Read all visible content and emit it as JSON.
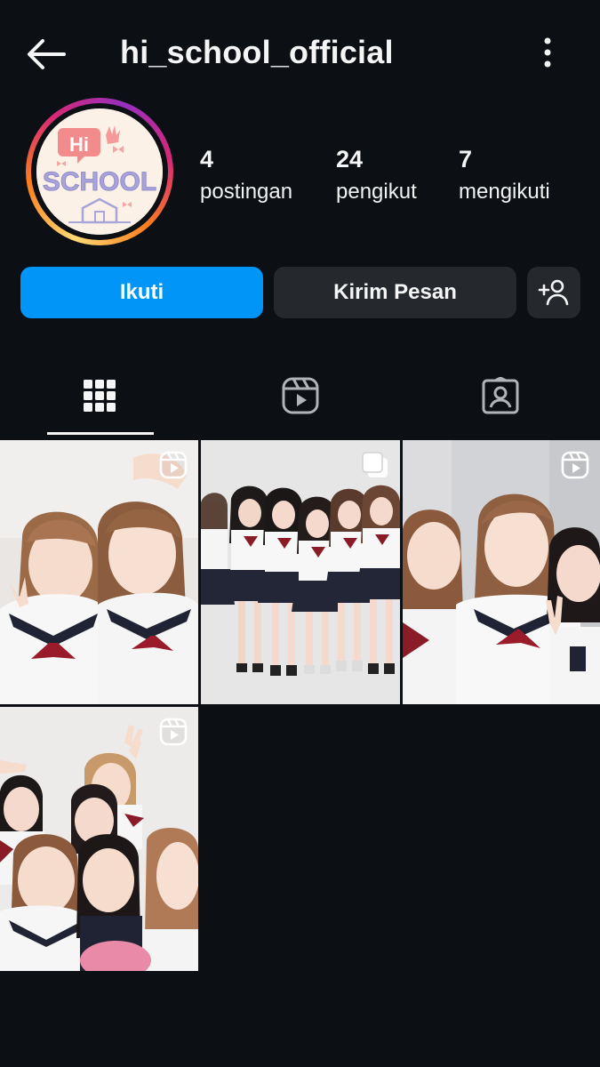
{
  "header": {
    "username": "hi_school_official",
    "back_icon": "arrow-left-icon",
    "more_icon": "more-vertical-icon"
  },
  "profile": {
    "avatar_logo_text_top": "Hi",
    "avatar_logo_text_main": "SCHOOL",
    "stats": {
      "posts": {
        "value": "4",
        "label": "postingan"
      },
      "followers": {
        "value": "24",
        "label": "pengikut"
      },
      "following": {
        "value": "7",
        "label": "mengikuti"
      }
    }
  },
  "actions": {
    "follow_label": "Ikuti",
    "message_label": "Kirim Pesan",
    "add_user_icon": "add-user-icon"
  },
  "tabs": [
    {
      "name": "posts-grid",
      "icon": "grid-icon",
      "active": true
    },
    {
      "name": "reels",
      "icon": "reels-icon",
      "active": false
    },
    {
      "name": "tagged",
      "icon": "tagged-user-icon",
      "active": false
    }
  ],
  "posts": [
    {
      "type": "reel",
      "badge_icon": "reels-icon"
    },
    {
      "type": "carousel",
      "badge_icon": "carousel-icon"
    },
    {
      "type": "reel",
      "badge_icon": "reels-icon"
    },
    {
      "type": "reel",
      "badge_icon": "reels-icon"
    }
  ],
  "colors": {
    "background": "#0c1014",
    "follow_button": "#0095f6",
    "secondary_button": "#25292e",
    "text": "#f5f5f5"
  }
}
